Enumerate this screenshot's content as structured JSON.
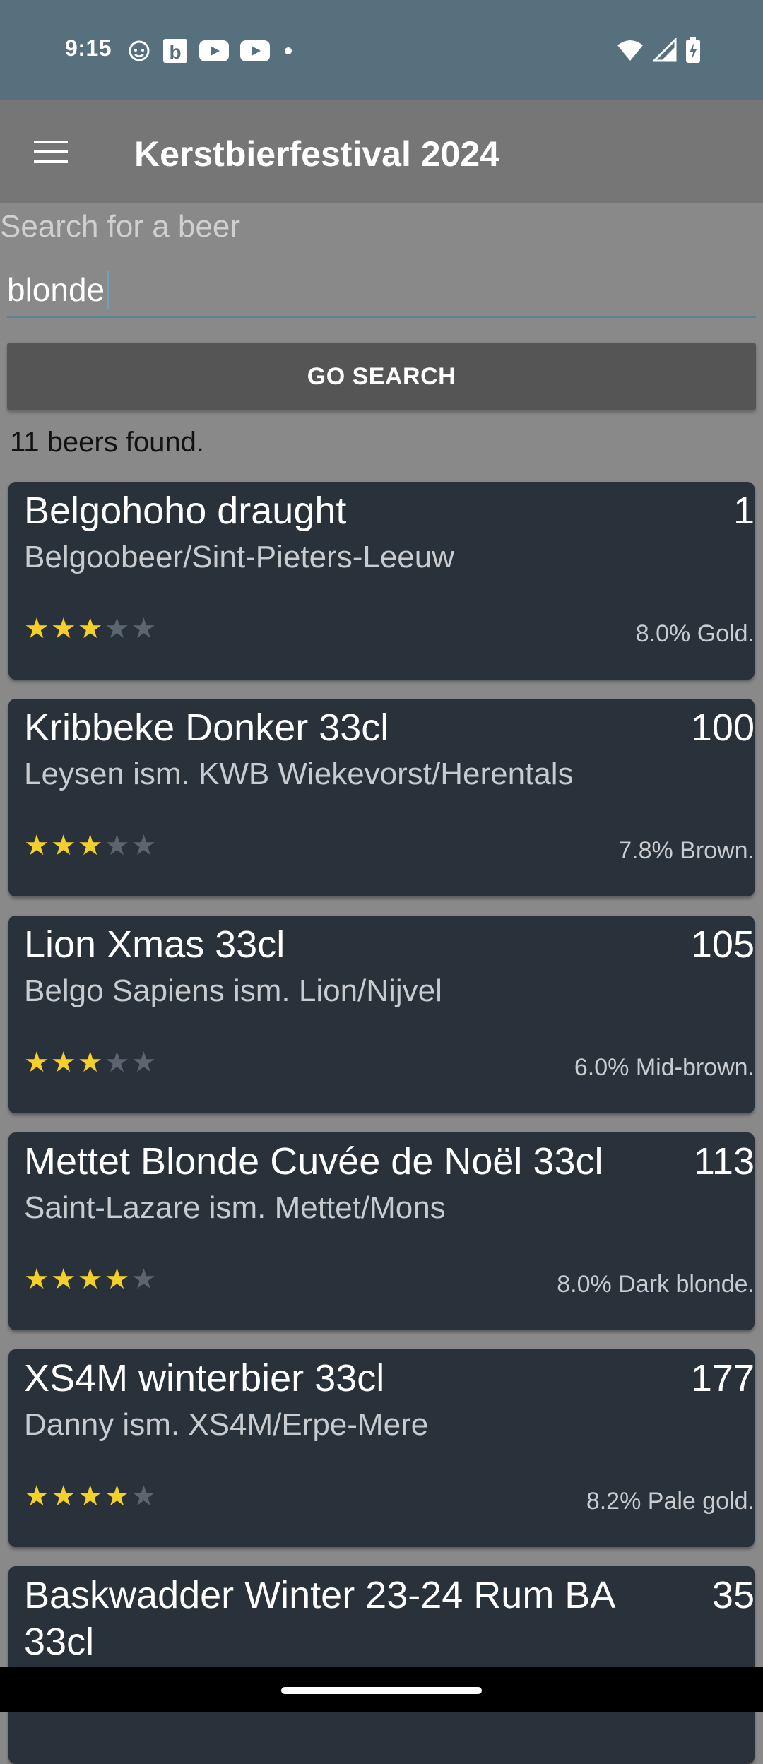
{
  "status": {
    "time": "9:15",
    "icons_left": [
      "face-icon",
      "b-app-icon",
      "youtube-icon",
      "youtube-icon",
      "dot-icon"
    ],
    "icons_right": [
      "wifi-icon",
      "signal-icon",
      "battery-charging-icon"
    ]
  },
  "appbar": {
    "title": "Kerstbierfestival 2024",
    "menu_icon": "hamburger-menu-icon"
  },
  "search": {
    "label": "Search for a beer",
    "value": "blonde",
    "button": "GO SEARCH"
  },
  "results": {
    "count_text": "11 beers found."
  },
  "colors": {
    "card_bg": "#29313a",
    "star_on": "#f5cf2a",
    "star_off": "#5b6570",
    "status_bar": "#56707e",
    "app_bar": "#767676"
  },
  "beers": [
    {
      "name": "Belgohoho draught",
      "number": "1",
      "brewer": "Belgoobeer/Sint-Pieters-Leeuw",
      "rating": 3,
      "rating_max": 5,
      "style": "8.0% Gold."
    },
    {
      "name": "Kribbeke Donker  33cl",
      "number": "100",
      "brewer": "Leysen ism. KWB Wiekevorst/Herentals",
      "rating": 3,
      "rating_max": 5,
      "style": "7.8% Brown."
    },
    {
      "name": "Lion Xmas 33cl",
      "number": "105",
      "brewer": "Belgo Sapiens ism. Lion/Nijvel",
      "rating": 3,
      "rating_max": 5,
      "style": "6.0% Mid-brown."
    },
    {
      "name": "Mettet Blonde Cuvée de Noël 33cl",
      "number": "113",
      "brewer": "Saint-Lazare ism. Mettet/Mons",
      "rating": 4,
      "rating_max": 5,
      "style": "8.0% Dark blonde."
    },
    {
      "name": "XS4M winterbier  33cl",
      "number": "177",
      "brewer": "Danny ism. XS4M/Erpe-Mere",
      "rating": 4,
      "rating_max": 5,
      "style": "8.2% Pale gold."
    },
    {
      "name": "Baskwadder Winter 23-24 Rum BA 33cl",
      "number": "35",
      "brewer": "",
      "rating": null,
      "rating_max": 5,
      "style": ""
    }
  ]
}
